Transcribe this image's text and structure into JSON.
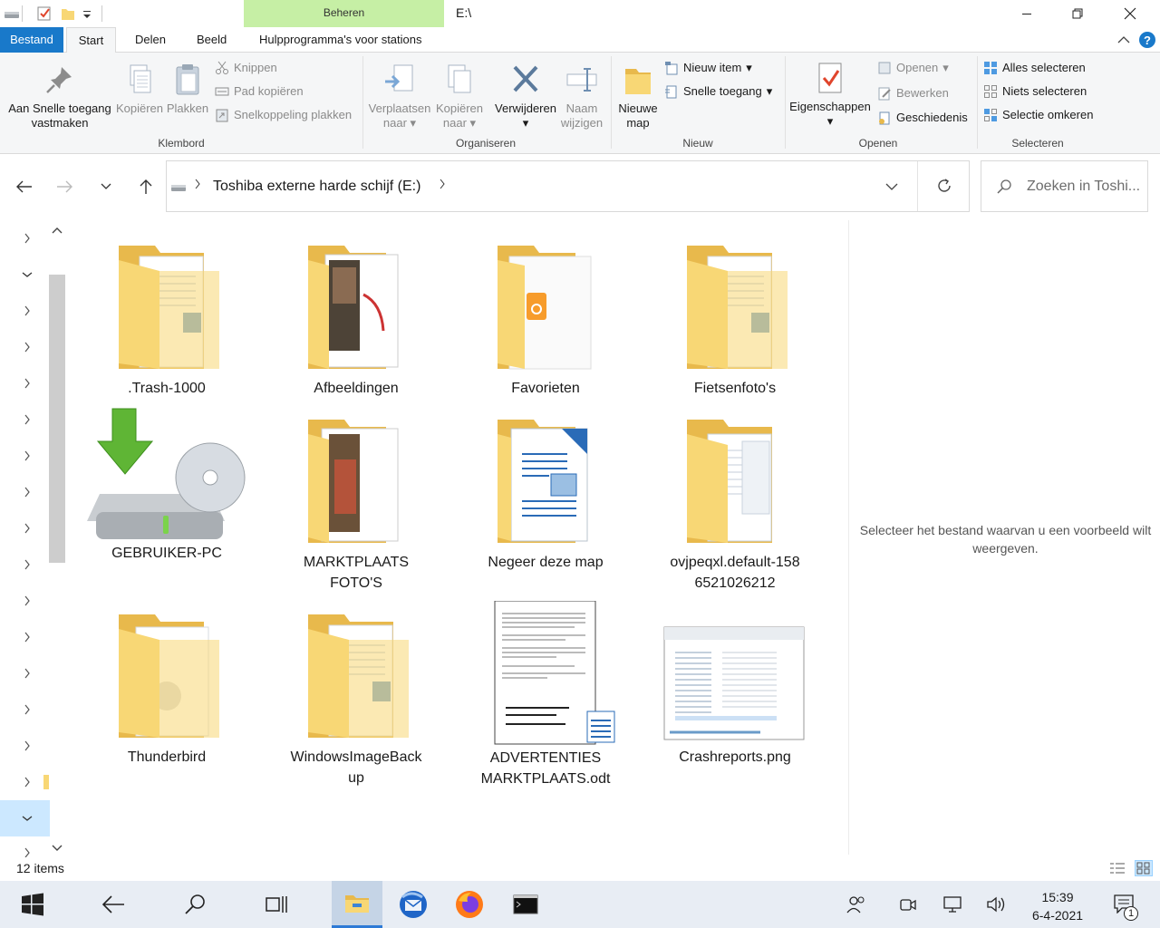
{
  "titlebar": {
    "context_tab": "Beheren",
    "path": "E:\\",
    "minimize": "minimize-icon",
    "maximize": "restore-icon",
    "close": "close-icon"
  },
  "tabs": {
    "bestand": "Bestand",
    "start": "Start",
    "delen": "Delen",
    "beeld": "Beeld",
    "tools": "Hulpprogramma's voor stations"
  },
  "ribbon": {
    "klembord": {
      "label": "Klembord",
      "pin_line1": "Aan Snelle toegang",
      "pin_line2": "vastmaken",
      "copy": "Kopiëren",
      "paste": "Plakken",
      "cut": "Knippen",
      "copy_path": "Pad kopiëren",
      "paste_shortcut": "Snelkoppeling plakken"
    },
    "organiseren": {
      "label": "Organiseren",
      "move_line1": "Verplaatsen",
      "move_line2": "naar",
      "copyto_line1": "Kopiëren",
      "copyto_line2": "naar",
      "delete": "Verwijderen",
      "rename_line1": "Naam",
      "rename_line2": "wijzigen"
    },
    "nieuw": {
      "label": "Nieuw",
      "folder_line1": "Nieuwe",
      "folder_line2": "map",
      "new_item": "Nieuw item",
      "easy_access": "Snelle toegang"
    },
    "openen": {
      "label": "Openen",
      "properties": "Eigenschappen",
      "open": "Openen",
      "edit": "Bewerken",
      "history": "Geschiedenis"
    },
    "selecteren": {
      "label": "Selecteren",
      "select_all": "Alles selecteren",
      "select_none": "Niets selecteren",
      "invert": "Selectie omkeren"
    }
  },
  "address": {
    "location": "Toshiba externe harde schijf (E:)",
    "search_placeholder": "Zoeken in Toshi..."
  },
  "items": [
    {
      "name": ".Trash-1000",
      "line2": "",
      "kind": "folder"
    },
    {
      "name": "Afbeeldingen",
      "line2": "",
      "kind": "folder-photos"
    },
    {
      "name": "Favorieten",
      "line2": "",
      "kind": "folder-favorites"
    },
    {
      "name": "Fietsenfoto's",
      "line2": "",
      "kind": "folder"
    },
    {
      "name": "GEBRUIKER-PC",
      "line2": "",
      "kind": "backup-drive"
    },
    {
      "name": "MARKTPLAATS",
      "line2": "FOTO'S",
      "kind": "folder-photos"
    },
    {
      "name": "Negeer deze map",
      "line2": "",
      "kind": "folder-doc"
    },
    {
      "name": "ovjpeqxl.default-158",
      "line2": "6521026212",
      "kind": "folder"
    },
    {
      "name": "Thunderbird",
      "line2": "",
      "kind": "folder"
    },
    {
      "name": "WindowsImageBack",
      "line2": "up",
      "kind": "folder"
    },
    {
      "name": "ADVERTENTIES",
      "line2": "MARKTPLAATS.odt",
      "kind": "odt-document"
    },
    {
      "name": "Crashreports.png",
      "line2": "",
      "kind": "png-screenshot"
    }
  ],
  "preview": {
    "message": "Selecteer het bestand waarvan u een voorbeeld wilt weergeven."
  },
  "status": {
    "count": "12 items"
  },
  "taskbar": {
    "time": "15:39",
    "date": "6-4-2021",
    "notifications": "1"
  }
}
